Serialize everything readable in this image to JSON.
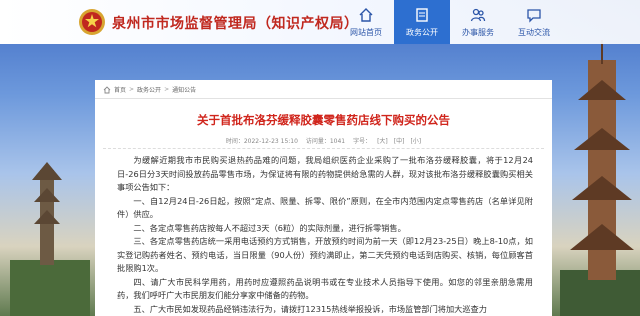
{
  "header": {
    "site_title": "泉州市市场监督管理局（知识产权局）",
    "nav": [
      {
        "label": "网站首页",
        "icon": "home-icon",
        "active": false
      },
      {
        "label": "政务公开",
        "icon": "document-icon",
        "active": true
      },
      {
        "label": "办事服务",
        "icon": "people-icon",
        "active": false
      },
      {
        "label": "互动交流",
        "icon": "chat-icon",
        "active": false
      }
    ]
  },
  "breadcrumb": {
    "home": "首页",
    "level1": "政务公开",
    "level2": "通知公告"
  },
  "article": {
    "title": "关于首批布洛芬缓释胶囊零售药店线下购买的公告",
    "date_label": "时间：2022-12-23 15:10",
    "views_label": "访问量：1041",
    "font_size_label": "字号：",
    "font_large": "[大]",
    "font_mid": "[中]",
    "font_small": "[小]",
    "paragraphs": [
      "为缓解近期我市市民购买退热药品难的问题，我局组织医药企业采购了一批布洛芬缓释胶囊，将于12月24日-26日分3天时间投放药品零售市场，为保证将有限的药物提供给急需的人群，现对该批布洛芬缓释胶囊购买相关事项公告如下：",
      "一、自12月24日-26日起，按照“定点、限量、拆零、限价”原则，在全市内范围内定点零售药店（名单详见附件）供应。",
      "二、各定点零售药店按每人不超过3天（6粒）的实际剂量，进行拆零销售。",
      "三、各定点零售药店统一采用电话预约方式销售，开放预约时间为前一天（即12月23-25日）晚上8-10点，如实登记购药者姓名、预约电话，当日限量（90人份）预约满即止，第二天凭预约电话到店购买、核销，每位顾客首批限购1次。",
      "四、请广大市民科学用药，用药时应遵照药品说明书或在专业技术人员指导下使用。如您的邻里亲朋急需用药，我们呼吁广大市民朋友们能分享家中储备的药物。",
      "五、广大市民如发现药品经销违法行为，请拨打12315热线举报投诉，市场监管部门将加大巡查力"
    ]
  }
}
